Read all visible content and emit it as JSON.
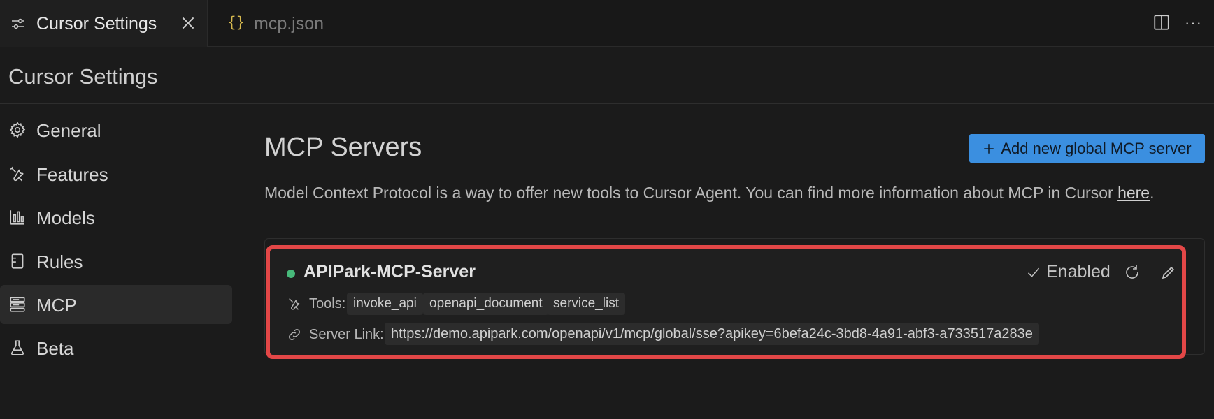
{
  "tabs": [
    {
      "label": "Cursor Settings",
      "icon": "sliders-icon",
      "active": true
    },
    {
      "label": "mcp.json",
      "icon": "json-braces-icon",
      "active": false
    }
  ],
  "page": {
    "title": "Cursor Settings"
  },
  "sidebar": {
    "items": [
      {
        "label": "General",
        "icon": "gear-icon"
      },
      {
        "label": "Features",
        "icon": "tools-icon"
      },
      {
        "label": "Models",
        "icon": "bar-chart-icon"
      },
      {
        "label": "Rules",
        "icon": "document-icon"
      },
      {
        "label": "MCP",
        "icon": "server-icon",
        "active": true
      },
      {
        "label": "Beta",
        "icon": "flask-icon"
      }
    ]
  },
  "main": {
    "title": "MCP Servers",
    "add_button": "Add new global MCP server",
    "description_text": "Model Context Protocol is a way to offer new tools to Cursor Agent. You can find more information about MCP in Cursor ",
    "description_link": "here",
    "description_end": ".",
    "server": {
      "name": "APIPark-MCP-Server",
      "status": "Enabled",
      "tools_label": "Tools:",
      "tools": [
        "invoke_api",
        "openapi_document",
        "service_list"
      ],
      "link_label": "Server Link:",
      "link": "https://demo.apipark.com/openapi/v1/mcp/global/sse?apikey=6befa24c-3bd8-4a91-abf3-a733517a283e"
    }
  },
  "colors": {
    "accent": "#3b8fe0",
    "status_green": "#47b97a",
    "highlight_border": "#e34747",
    "json_icon": "#d7ba4f"
  }
}
